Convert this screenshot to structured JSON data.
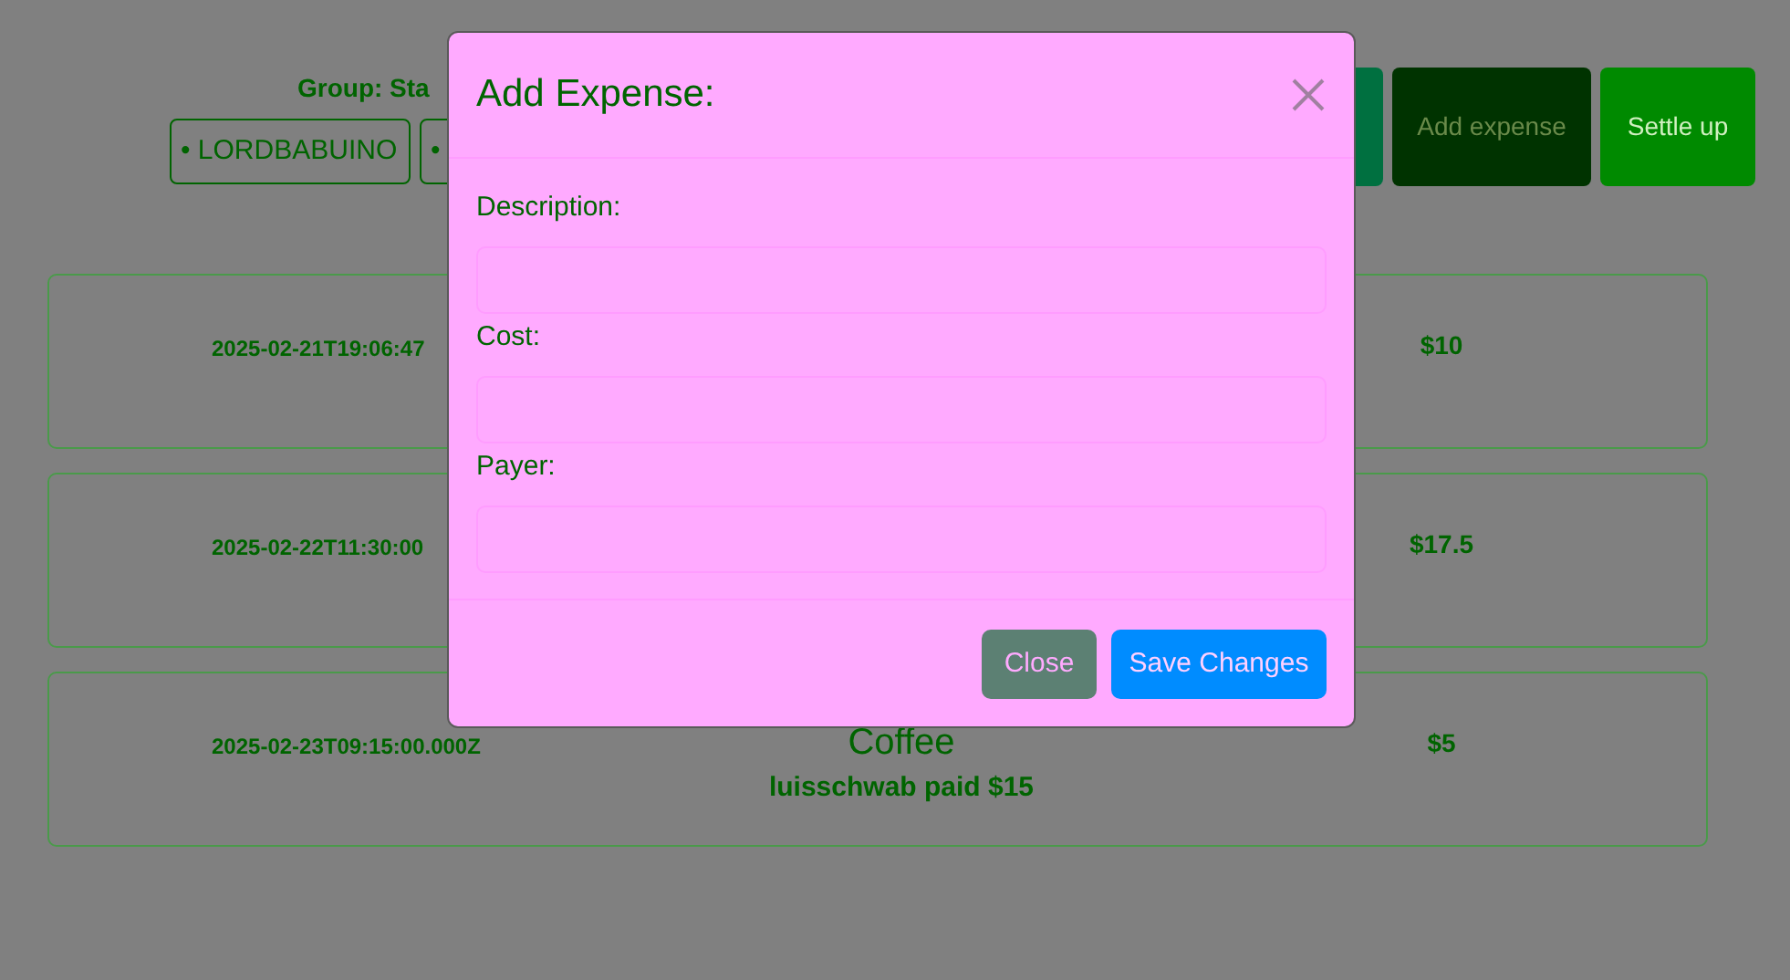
{
  "group_header": {
    "title": "Group: Sta",
    "members": [
      "• LORDBABUINO",
      "•"
    ]
  },
  "actions": [
    {
      "kind": "covered"
    },
    {
      "kind": "add",
      "label": "Add expense"
    },
    {
      "kind": "settle",
      "label": "Settle up"
    }
  ],
  "expenses": [
    {
      "date": "2025-02-21T19:06:47",
      "amount": "$10"
    },
    {
      "date": "2025-02-22T11:30:00",
      "amount": "$17.5"
    },
    {
      "date": "2025-02-23T09:15:00.000Z",
      "title": "Coffee",
      "paid_by": "luisschwab paid $15",
      "amount": "$5"
    }
  ],
  "modal": {
    "title": "Add Expense:",
    "fields": [
      {
        "label": "Description:"
      },
      {
        "label": "Cost:"
      },
      {
        "label": "Payer:"
      }
    ],
    "buttons": [
      {
        "label": "Close",
        "kind": "secondary"
      },
      {
        "label": "Save Changes",
        "kind": "primary"
      }
    ]
  }
}
